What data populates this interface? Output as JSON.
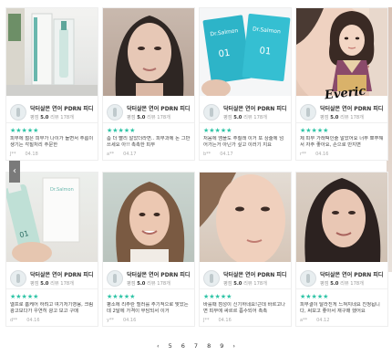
{
  "nav": {
    "prev_icon": "‹"
  },
  "logo_text": "Everic",
  "pagination": [
    "5",
    "6",
    "7",
    "8",
    "9"
  ],
  "pagination_prev": "‹",
  "pagination_next": "›",
  "colors": {
    "star": "#2ec4a6",
    "accent": "#6ab7ad"
  },
  "cards": [
    {
      "product": "닥터살몬 연어 PDRN 피디",
      "rating_label": "평점",
      "rating": "5.0",
      "review_label": "리뷰",
      "review_count": "178개",
      "stars": "★★★★★",
      "text": "피부에 젊은 피부가 나이가 들면서 주름이 생기는 각질처리 주문한",
      "user": "J**",
      "date": "04.18"
    },
    {
      "product": "닥터살몬 연어 PDRN 피디",
      "rating_label": "평점",
      "rating": "5.0",
      "review_label": "리뷰",
      "review_count": "178개",
      "stars": "★★★★★",
      "text": "좀 더 빨리 알았더라면.. 피부과에 돈 그만 쓰세요 아!! 촉촉한 피부",
      "user": "a**",
      "date": "04.17"
    },
    {
      "product": "닥터살몬 연어 PDRN 피디",
      "rating_label": "평점",
      "rating": "5.0",
      "review_label": "리뷰",
      "review_count": "178개",
      "stars": "★★★★★",
      "text": "처음에 앰플도 주질래 이거 또 상술에 넘어가는거 아닌가 싶고 이러기 지요",
      "user": "b**",
      "date": "04.17"
    },
    {
      "product": "닥터살몬 연어 PDRN 피디",
      "rating_label": "평점",
      "rating": "5.0",
      "review_label": "리뷰",
      "review_count": "178개",
      "stars": "★★★★★",
      "text": "제 피부 가래떡인줄 알았어요 너무 뽀쭈해서 자주 좋아요, 손으로 만지면",
      "user": "r**",
      "date": "04.16"
    },
    {
      "product": "닥터살몬 연어 PDRN 피디",
      "rating_label": "평점",
      "rating": "5.0",
      "review_label": "리뷰",
      "review_count": "178개",
      "stars": "★★★★★",
      "text": "엘프로 홈케어 하려고 여기저기영용, 크림 광고보다가 우연히 광고 보고 구매",
      "user": "d**",
      "date": "04.16"
    },
    {
      "product": "닥터살몬 연어 PDRN 피디",
      "rating_label": "평점",
      "rating": "5.0",
      "review_label": "리뷰",
      "review_count": "178개",
      "stars": "★★★★★",
      "text": "평소에 리주란 힐러를 주기적으로 맞았는데 2달에 가격이 부담되서 이거",
      "user": "y**",
      "date": "04.16"
    },
    {
      "product": "닥터살몬 연어 PDRN 피디",
      "rating_label": "평점",
      "rating": "5.0",
      "review_label": "리뷰",
      "review_count": "178개",
      "stars": "★★★★★",
      "text": "바를때 점성이 신기하네요!근데 바르고나면 피부에 싸르르 흡수되어 촉촉",
      "user": "J**",
      "date": "04.16"
    },
    {
      "product": "닥터살몬 연어 PDRN 피디",
      "rating_label": "평점",
      "rating": "5.0",
      "review_label": "리뷰",
      "review_count": "178개",
      "stars": "★★★★★",
      "text": "피부결이 달라진게 느껴지네요 진정됩니다, 써보고 좋아서 재구매 했어요",
      "user": "a**",
      "date": "04.12"
    }
  ]
}
